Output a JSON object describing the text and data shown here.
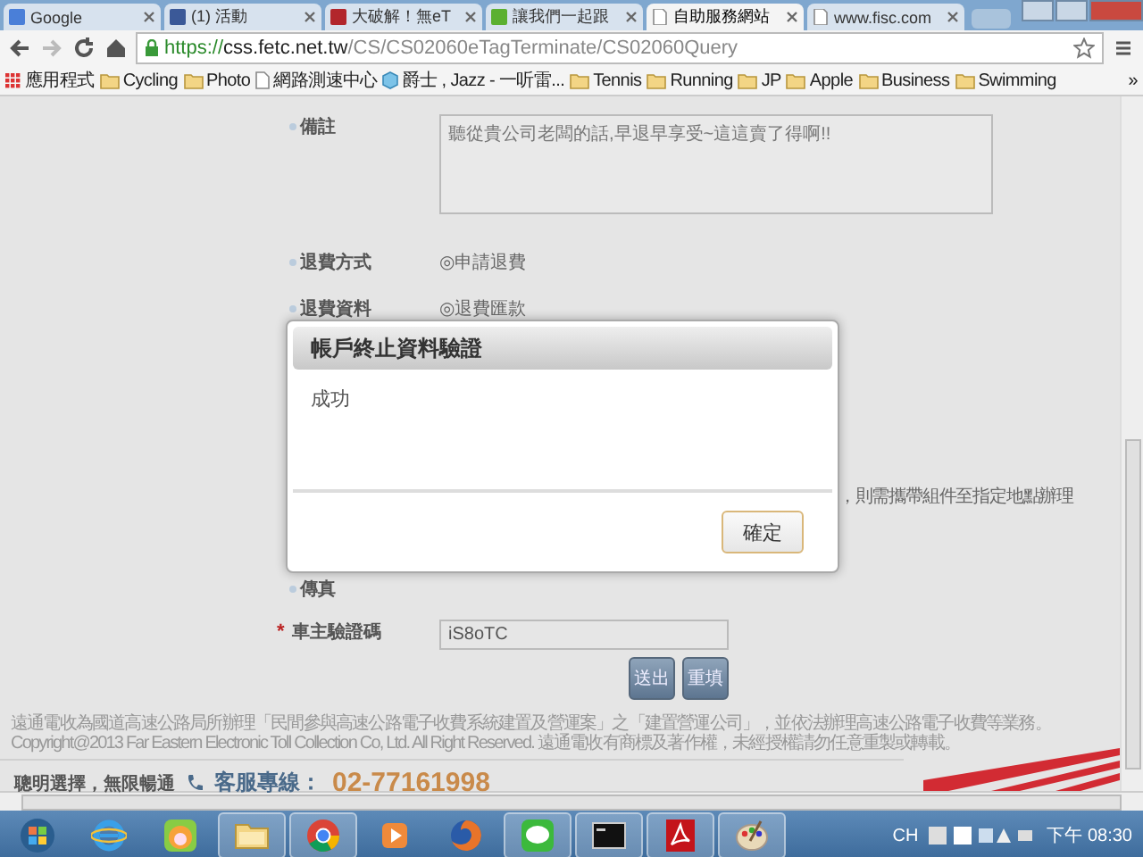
{
  "browser": {
    "tabs": [
      {
        "title": "Google",
        "kind": "blue",
        "selected": false
      },
      {
        "title": "(1) 活動",
        "kind": "navy",
        "selected": false
      },
      {
        "title": "大破解！無eT",
        "kind": "red",
        "selected": false
      },
      {
        "title": "讓我們一起跟",
        "kind": "green",
        "selected": false
      },
      {
        "title": "自助服務網站",
        "kind": "page",
        "selected": true
      },
      {
        "title": "www.fisc.com",
        "kind": "page",
        "selected": false
      }
    ],
    "url": {
      "scheme": "https://",
      "host": "css.fetc.net.tw",
      "path": "/CS/CS02060eTagTerminate/CS02060Query"
    },
    "bookmarks": [
      {
        "label": "應用程式",
        "kind": "apps"
      },
      {
        "label": "Cycling",
        "kind": "folder"
      },
      {
        "label": "Photo",
        "kind": "folder"
      },
      {
        "label": "網路測速中心",
        "kind": "page"
      },
      {
        "label": "爵士 , Jazz - 一听雷...",
        "kind": "site"
      },
      {
        "label": "Tennis",
        "kind": "folder"
      },
      {
        "label": "Running",
        "kind": "folder"
      },
      {
        "label": "JP",
        "kind": "folder"
      },
      {
        "label": "Apple",
        "kind": "folder"
      },
      {
        "label": "Business",
        "kind": "folder"
      },
      {
        "label": "Swimming",
        "kind": "folder"
      }
    ],
    "more": "»"
  },
  "form": {
    "remarks": {
      "label": "備註",
      "value": "聽從貴公司老闆的話,早退早享受~這這賣了得啊!!"
    },
    "refund_method": {
      "label": "退費方式",
      "option": "◎申請退費"
    },
    "refund_data": {
      "label": "退費資料",
      "option": "◎退費匯款"
    },
    "note": "，則需攜帶組件至指定地點辦理",
    "fax": {
      "label": "傳真"
    },
    "verify": {
      "required_mark": "*",
      "label": "車主驗證碼",
      "value": "iS8oTC"
    },
    "buttons": [
      "送出",
      "重填"
    ]
  },
  "footer": {
    "lines": [
      "遠通電收為國道高速公路局所辦理「民間參與高速公路電子收費系統建置及營運案」之「建置營運公司」，並依法辦理高速公路電子收費等業務。",
      "Copyright@2013 Far Eastern Electronic Toll Collection Co, Ltd. All Right Reserved. 遠通電收有商標及著作權，未經授權請勿任意重製或轉載。"
    ],
    "slogan": "聰明選擇，無限暢通",
    "hotline_label": "客服專線：",
    "hotline": "02-77161998"
  },
  "dialog": {
    "title": "帳戶終止資料驗證",
    "message": "成功",
    "button": "確定"
  },
  "taskbar": {
    "apps": [
      {
        "kind": "start",
        "running": false
      },
      {
        "kind": "ie",
        "running": false
      },
      {
        "kind": "chat",
        "running": false
      },
      {
        "kind": "folder",
        "running": true
      },
      {
        "kind": "chrome",
        "running": true
      },
      {
        "kind": "media",
        "running": false
      },
      {
        "kind": "firefox",
        "running": false
      },
      {
        "kind": "line",
        "running": true
      },
      {
        "kind": "terminal",
        "running": true
      },
      {
        "kind": "pdf",
        "running": true
      },
      {
        "kind": "paint",
        "running": true
      }
    ],
    "language": "CH",
    "clock": "下午 08:30"
  }
}
